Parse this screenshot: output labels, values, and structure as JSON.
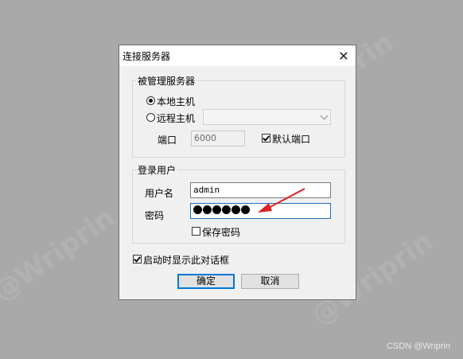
{
  "dialog": {
    "title": "连接服务器",
    "close_label": "✕"
  },
  "server_group": {
    "label": "被管理服务器",
    "local_host_label": "本地主机",
    "remote_host_label": "远程主机",
    "port_label": "端口",
    "port_value": "6000",
    "default_port_label": "默认端口",
    "local_selected": true,
    "default_port_checked": true
  },
  "login_group": {
    "label": "登录用户",
    "username_label": "用户名",
    "username_value": "admin",
    "password_label": "密码",
    "password_masked_length": 6,
    "save_password_label": "保存密码",
    "save_password_checked": false
  },
  "options": {
    "show_on_startup_label": "启动时显示此对话框",
    "show_on_startup_checked": true
  },
  "buttons": {
    "ok_label": "确定",
    "cancel_label": "取消"
  },
  "watermark": {
    "text": "CSDN @Wriprin"
  },
  "colors": {
    "background": "#a9a9a9",
    "dialog_bg": "#f0f0f0",
    "annotation_arrow": "#e02020",
    "focus_border": "#1e6fb8"
  },
  "icons": {
    "close": "close-icon",
    "combo_arrow": "chevron-down-icon",
    "annotation": "red-arrow-icon"
  }
}
